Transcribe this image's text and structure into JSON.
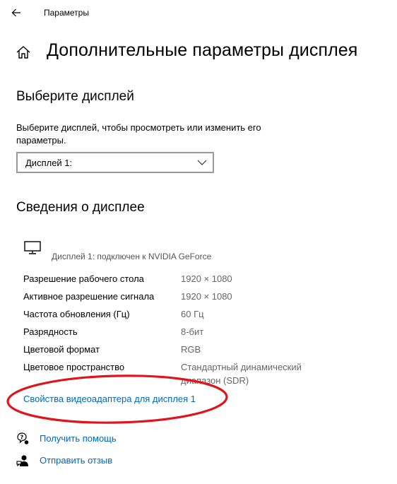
{
  "titlebar": {
    "title": "Параметры"
  },
  "page": {
    "title": "Дополнительные параметры дисплея"
  },
  "select_display": {
    "heading": "Выберите дисплей",
    "description_line1": "Выберите дисплей, чтобы просмотреть или изменить его",
    "description_line2": "параметры.",
    "dropdown_value": "Дисплей 1:"
  },
  "display_info": {
    "heading": "Сведения о дисплее",
    "caption": "Дисплей 1: подключен к NVIDIA GeForce",
    "rows": [
      {
        "label": "Разрешение рабочего стола",
        "value": "1920 × 1080"
      },
      {
        "label": "Активное разрешение сигнала",
        "value": "1920 × 1080"
      },
      {
        "label": "Частота обновления (Гц)",
        "value": "60 Гц"
      },
      {
        "label": "Разрядность",
        "value": "8-бит"
      },
      {
        "label": "Цветовой формат",
        "value": "RGB"
      },
      {
        "label": "Цветовое пространство",
        "value": "Стандартный динамический",
        "value_line2": "диапазон (SDR)"
      }
    ],
    "adapter_link": "Свойства видеоадаптера для дисплея 1"
  },
  "footer": {
    "help": "Получить помощь",
    "feedback": "Отправить отзыв"
  },
  "colors": {
    "link": "#0067c0",
    "annotation": "#e0141b"
  },
  "icons": [
    "back-arrow-icon",
    "home-icon",
    "chevron-down-icon",
    "monitor-icon",
    "help-icon",
    "feedback-icon"
  ]
}
